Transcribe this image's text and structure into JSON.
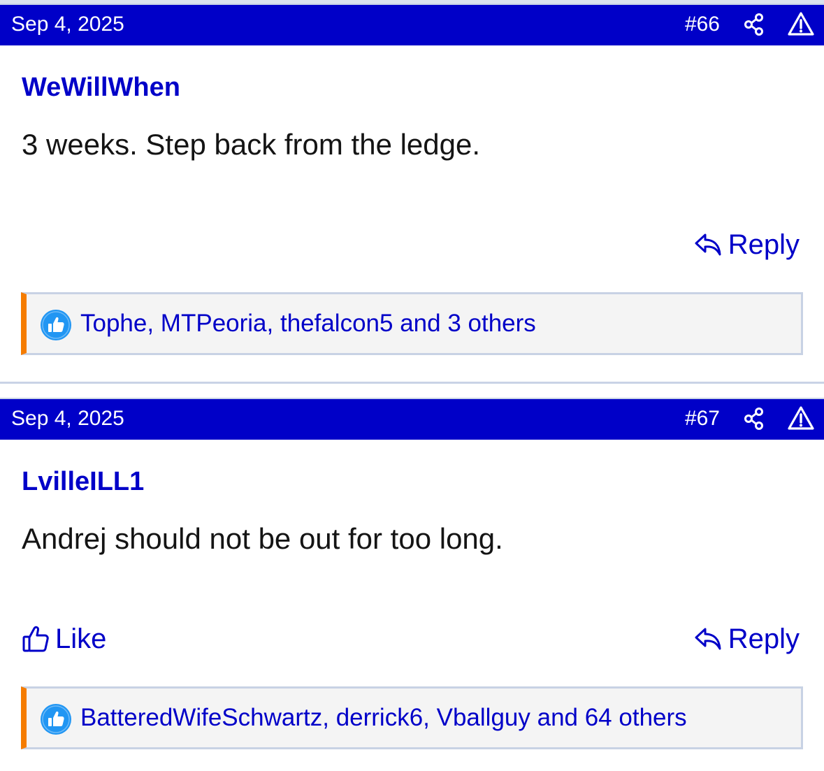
{
  "posts": [
    {
      "date": "Sep 4, 2025",
      "number": "#66",
      "username": "WeWillWhen",
      "message": "3 weeks. Step back from the ledge.",
      "reply_label": "Reply",
      "reactions_text": "Tophe, MTPeoria, thefalcon5 and 3 others"
    },
    {
      "date": "Sep 4, 2025",
      "number": "#67",
      "username": "LvilleILL1",
      "message": "Andrej should not be out for too long.",
      "like_label": "Like",
      "reply_label": "Reply",
      "reactions_text": "BatteredWifeSchwartz, derrick6, Vballguy and 64 others"
    }
  ],
  "colors": {
    "header_bg": "#0000c8",
    "link": "#0000c8",
    "reaction_accent": "#f57c00",
    "like_badge": "#2196f3"
  },
  "icons": [
    "share-icon",
    "report-icon",
    "reply-icon",
    "thumbs-up-icon",
    "like-badge-icon"
  ]
}
